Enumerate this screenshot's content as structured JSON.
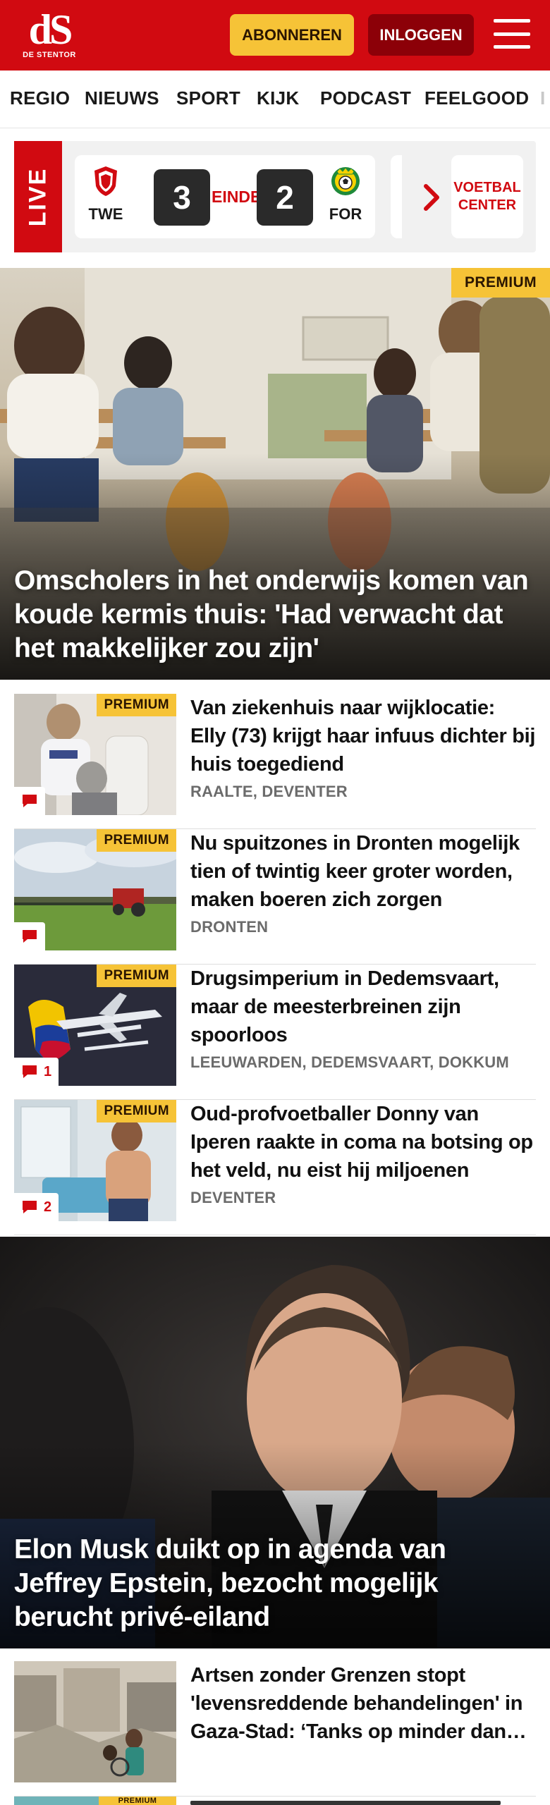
{
  "header": {
    "logo_mark": "dS",
    "logo_text": "DE STENTOR",
    "subscribe_label": "ABONNEREN",
    "login_label": "INLOGGEN",
    "menu_icon": "hamburger-menu-icon",
    "brand_red": "#d10a11",
    "subscribe_yellow": "#f6c337",
    "login_dark_red": "#8c0008"
  },
  "nav": {
    "items": [
      "REGIO",
      "NIEUWS",
      "SPORT",
      "KIJK",
      "PODCAST",
      "FEELGOOD",
      "I"
    ]
  },
  "live": {
    "tab_label": "LIVE",
    "match": {
      "home_code": "TWE",
      "home_score": "3",
      "status": "EINDE",
      "away_score": "2",
      "away_code": "FOR",
      "home_crest_icon": "fc-twente-crest-icon",
      "away_crest_icon": "fortuna-sittard-crest-icon"
    },
    "chevron_icon": "chevron-right-icon",
    "center_label": "VOETBAL CENTER"
  },
  "hero1": {
    "premium": "PREMIUM",
    "title": "Omscholers in het onderwijs komen van koude kermis thuis: 'Had verwacht dat het makkelijker zou zijn'"
  },
  "articles": [
    {
      "premium": "PREMIUM",
      "title": "Van ziekenhuis naar wijklocatie: Elly (73) krijgt haar infuus dichter bij huis toegediend",
      "meta": "RAALTE, DEVENTER",
      "comments": ""
    },
    {
      "premium": "PREMIUM",
      "title": "Nu spuitzones in Dronten mogelijk tien of twintig keer groter worden, maken boeren zich zorgen",
      "meta": "DRONTEN",
      "comments": ""
    },
    {
      "premium": "PREMIUM",
      "title": "Drugsimperium in Dedemsvaart, maar de meesterbreinen zijn spoorloos",
      "meta": "LEEUWARDEN, DEDEMSVAART, DOKKUM",
      "comments": "1"
    },
    {
      "premium": "PREMIUM",
      "title": "Oud-profvoetballer Donny van Iperen raakte in coma na botsing op het veld, nu eist hij miljoenen",
      "meta": "DEVENTER",
      "comments": "2"
    }
  ],
  "hero2": {
    "title": "Elon Musk duikt op in agenda van Jeffrey Epstein, bezocht mogelijk berucht privé-eiland"
  },
  "articles2": [
    {
      "title": "Artsen zonder Grenzen stopt 'levensreddende behandelingen' in Gaza-Stad: ‘Tanks op minder dan een kilometer’",
      "meta": "",
      "comments": ""
    }
  ],
  "partial": {
    "premium": "PREMIUM"
  }
}
